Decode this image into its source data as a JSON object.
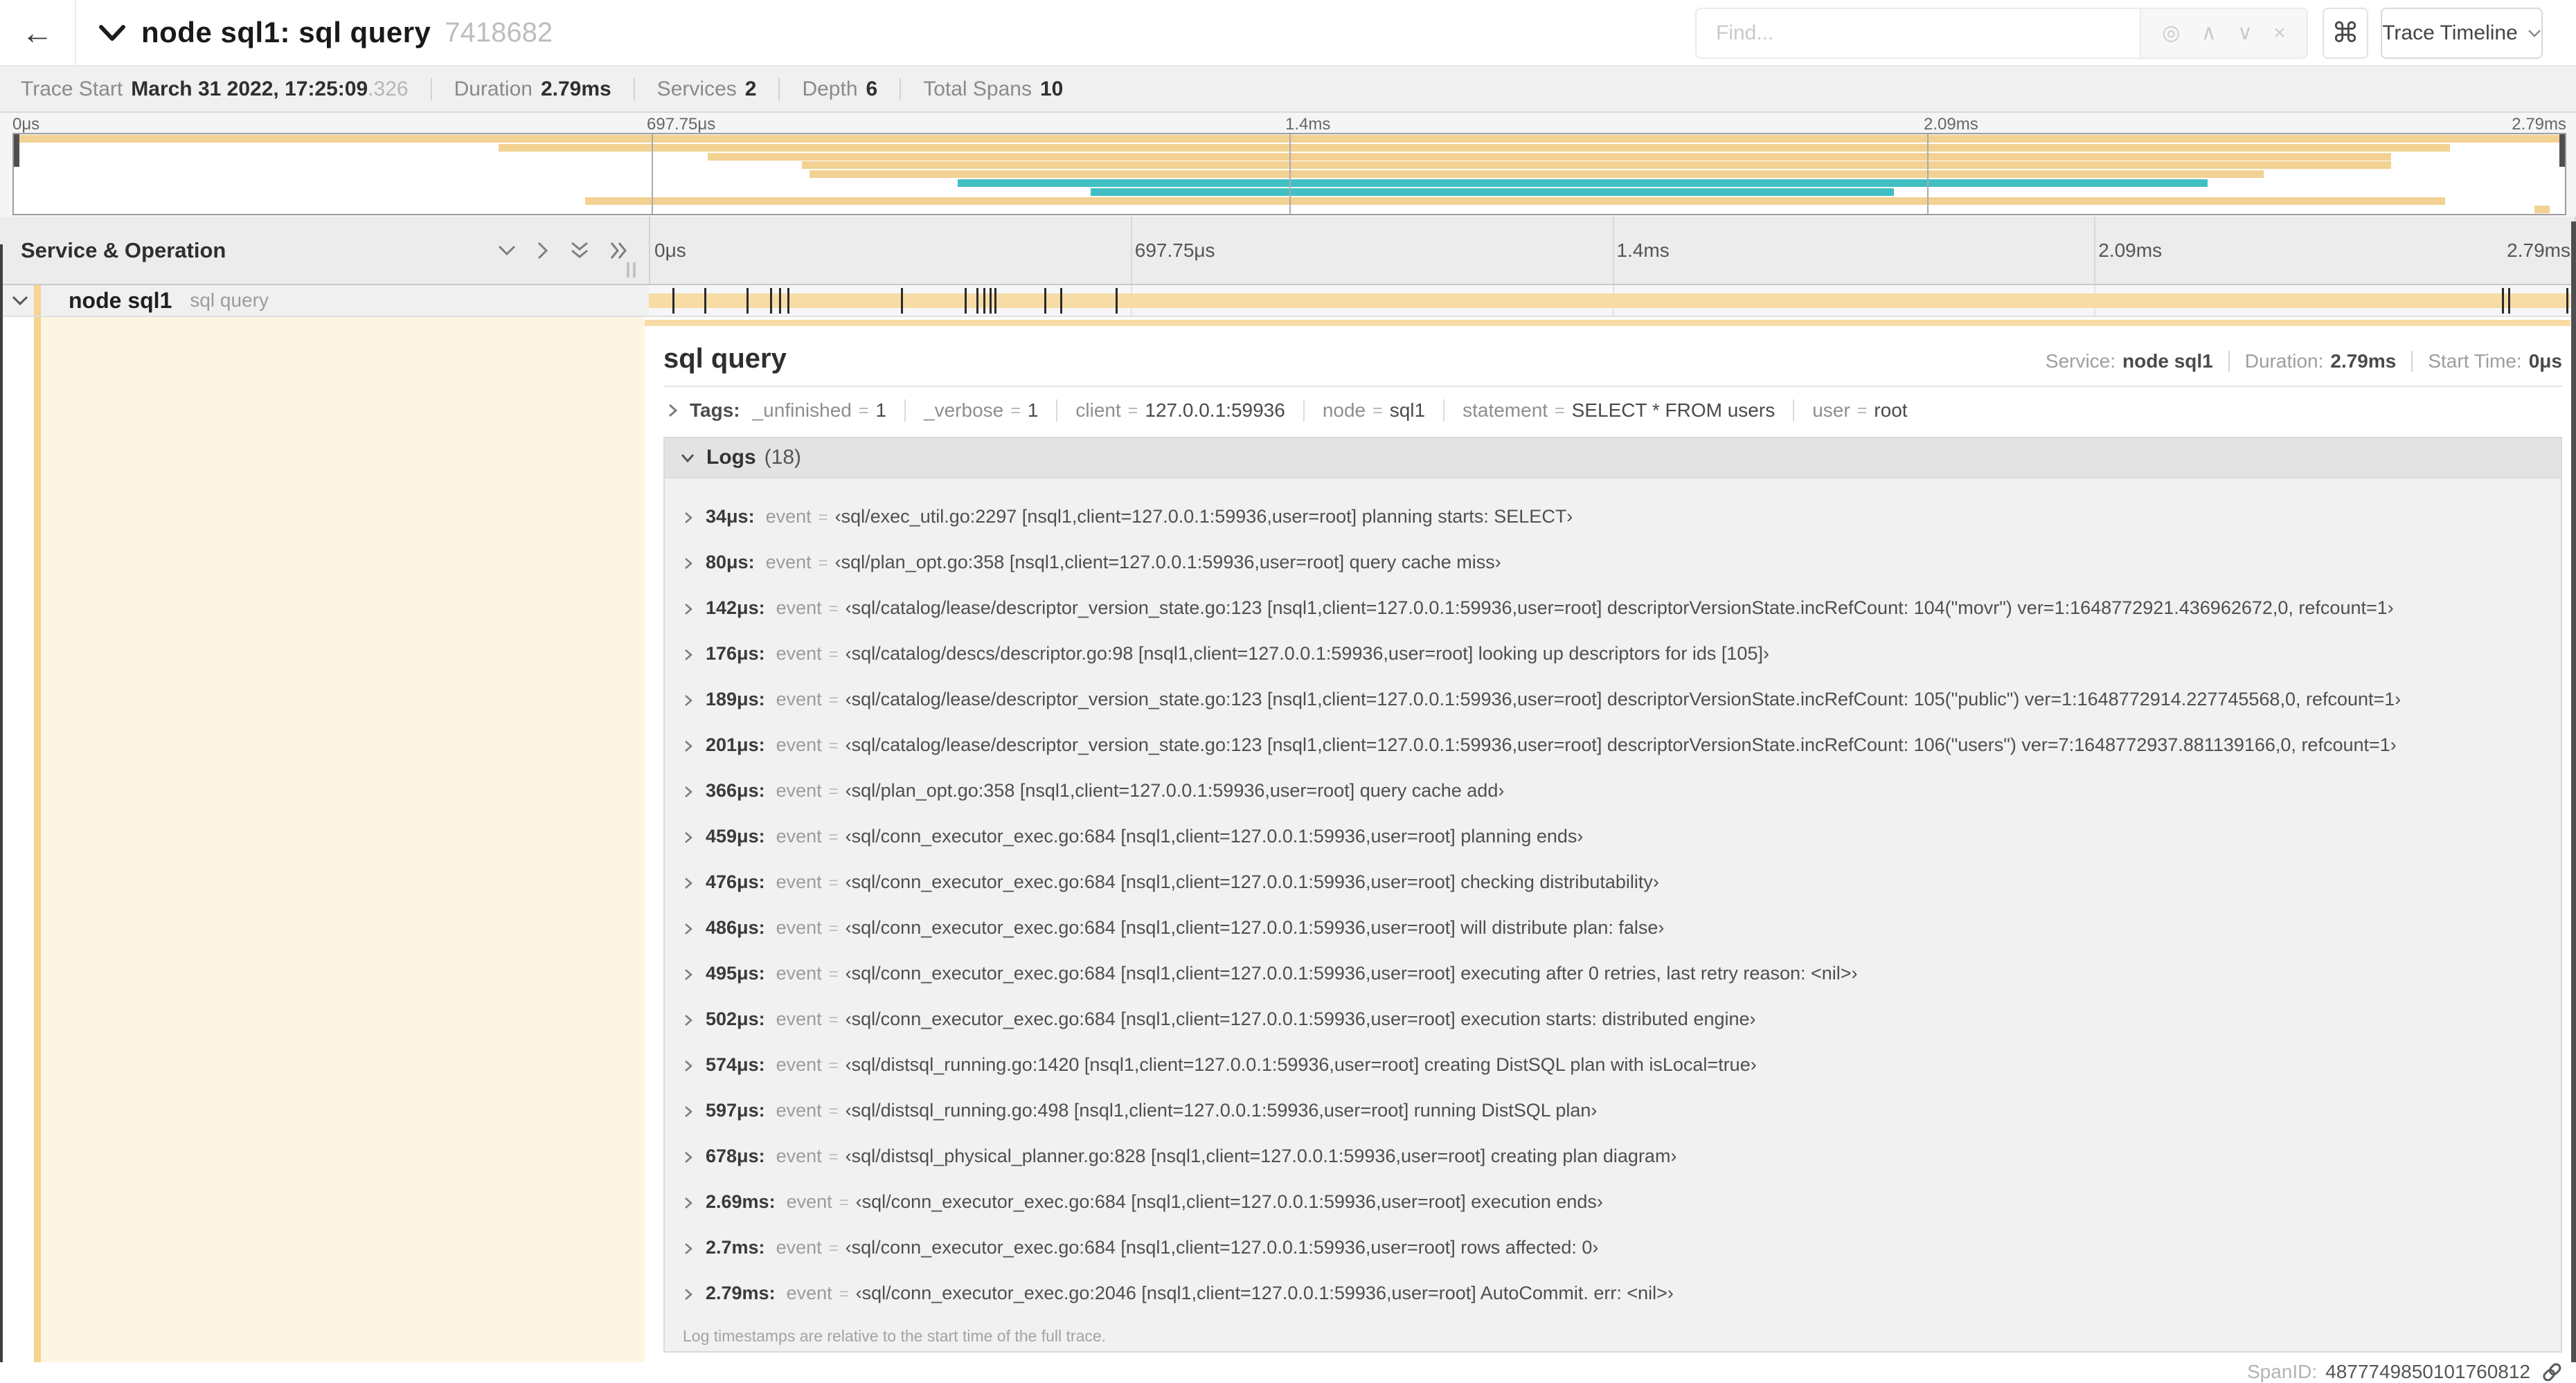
{
  "header": {
    "back_label": "←",
    "title": "node sql1: sql query",
    "trace_id": "7418682",
    "find_placeholder": "Find...",
    "locate_icon": "◎",
    "prev_icon": "∧",
    "next_icon": "∨",
    "clear_icon": "×",
    "cmd_icon": "⌘",
    "view_button": "Trace Timeline"
  },
  "trace_meta": {
    "trace_start_label": "Trace Start",
    "trace_start_value": "March 31 2022, 17:25:09",
    "trace_start_fraction": ".326",
    "duration_label": "Duration",
    "duration_value": "2.79ms",
    "services_label": "Services",
    "services_value": "2",
    "depth_label": "Depth",
    "depth_value": "6",
    "total_spans_label": "Total Spans",
    "total_spans_value": "10"
  },
  "timeline": {
    "left_header": "Service & Operation",
    "ticks": [
      "0μs",
      "697.75μs",
      "1.4ms",
      "2.09ms",
      "2.79ms"
    ],
    "tick_pcts": [
      0,
      25,
      50,
      75,
      100
    ]
  },
  "minimap": {
    "spans": [
      {
        "start_pct": 0,
        "end_pct": 100,
        "color": "#f2d192"
      },
      {
        "start_pct": 19.0,
        "end_pct": 95.5,
        "color": "#f2d192"
      },
      {
        "start_pct": 27.2,
        "end_pct": 93.2,
        "color": "#f2d192"
      },
      {
        "start_pct": 30.9,
        "end_pct": 93.2,
        "color": "#f2d192"
      },
      {
        "start_pct": 31.2,
        "end_pct": 88.2,
        "color": "#f2d192"
      },
      {
        "start_pct": 37.0,
        "end_pct": 86.0,
        "color": "#41bfc2"
      },
      {
        "start_pct": 42.2,
        "end_pct": 73.7,
        "color": "#41bfc2"
      },
      {
        "start_pct": 22.4,
        "end_pct": 95.3,
        "color": "#f2d192"
      },
      {
        "start_pct": 98.8,
        "end_pct": 99.4,
        "color": "#f2d192"
      }
    ]
  },
  "span_row": {
    "service": "node sql1",
    "operation": "sql query",
    "marker_pcts": [
      1.22,
      2.87,
      5.09,
      6.31,
      6.77,
      7.2,
      13.12,
      16.45,
      17.06,
      17.42,
      17.74,
      17.99,
      20.57,
      21.4,
      24.3,
      96.42,
      96.77,
      99.8
    ]
  },
  "detail": {
    "title": "sql query",
    "service_label": "Service:",
    "service_value": "node sql1",
    "duration_label": "Duration:",
    "duration_value": "2.79ms",
    "start_label": "Start Time:",
    "start_value": "0μs",
    "tags_label": "Tags:",
    "tags": [
      {
        "key": "_unfinished",
        "value": "1"
      },
      {
        "key": "_verbose",
        "value": "1"
      },
      {
        "key": "client",
        "value": "127.0.0.1:59936"
      },
      {
        "key": "node",
        "value": "sql1"
      },
      {
        "key": "statement",
        "value": "SELECT * FROM users"
      },
      {
        "key": "user",
        "value": "root"
      }
    ],
    "logs_label": "Logs",
    "logs_count": "(18)",
    "logs": [
      {
        "time": "34μs:",
        "field": "event",
        "value": "‹sql/exec_util.go:2297 [nsql1,client=127.0.0.1:59936,user=root] planning starts: SELECT›"
      },
      {
        "time": "80μs:",
        "field": "event",
        "value": "‹sql/plan_opt.go:358 [nsql1,client=127.0.0.1:59936,user=root] query cache miss›"
      },
      {
        "time": "142μs:",
        "field": "event",
        "value": "‹sql/catalog/lease/descriptor_version_state.go:123 [nsql1,client=127.0.0.1:59936,user=root] descriptorVersionState.incRefCount: 104(\"movr\") ver=1:1648772921.436962672,0, refcount=1›"
      },
      {
        "time": "176μs:",
        "field": "event",
        "value": "‹sql/catalog/descs/descriptor.go:98 [nsql1,client=127.0.0.1:59936,user=root] looking up descriptors for ids [105]›"
      },
      {
        "time": "189μs:",
        "field": "event",
        "value": "‹sql/catalog/lease/descriptor_version_state.go:123 [nsql1,client=127.0.0.1:59936,user=root] descriptorVersionState.incRefCount: 105(\"public\") ver=1:1648772914.227745568,0, refcount=1›"
      },
      {
        "time": "201μs:",
        "field": "event",
        "value": "‹sql/catalog/lease/descriptor_version_state.go:123 [nsql1,client=127.0.0.1:59936,user=root] descriptorVersionState.incRefCount: 106(\"users\") ver=7:1648772937.881139166,0, refcount=1›"
      },
      {
        "time": "366μs:",
        "field": "event",
        "value": "‹sql/plan_opt.go:358 [nsql1,client=127.0.0.1:59936,user=root] query cache add›"
      },
      {
        "time": "459μs:",
        "field": "event",
        "value": "‹sql/conn_executor_exec.go:684 [nsql1,client=127.0.0.1:59936,user=root] planning ends›"
      },
      {
        "time": "476μs:",
        "field": "event",
        "value": "‹sql/conn_executor_exec.go:684 [nsql1,client=127.0.0.1:59936,user=root] checking distributability›"
      },
      {
        "time": "486μs:",
        "field": "event",
        "value": "‹sql/conn_executor_exec.go:684 [nsql1,client=127.0.0.1:59936,user=root] will distribute plan: false›"
      },
      {
        "time": "495μs:",
        "field": "event",
        "value": "‹sql/conn_executor_exec.go:684 [nsql1,client=127.0.0.1:59936,user=root] executing after 0 retries, last retry reason: <nil>›"
      },
      {
        "time": "502μs:",
        "field": "event",
        "value": "‹sql/conn_executor_exec.go:684 [nsql1,client=127.0.0.1:59936,user=root] execution starts: distributed engine›"
      },
      {
        "time": "574μs:",
        "field": "event",
        "value": "‹sql/distsql_running.go:1420 [nsql1,client=127.0.0.1:59936,user=root] creating DistSQL plan with isLocal=true›"
      },
      {
        "time": "597μs:",
        "field": "event",
        "value": "‹sql/distsql_running.go:498 [nsql1,client=127.0.0.1:59936,user=root] running DistSQL plan›"
      },
      {
        "time": "678μs:",
        "field": "event",
        "value": "‹sql/distsql_physical_planner.go:828 [nsql1,client=127.0.0.1:59936,user=root] creating plan diagram›"
      },
      {
        "time": "2.69ms:",
        "field": "event",
        "value": "‹sql/conn_executor_exec.go:684 [nsql1,client=127.0.0.1:59936,user=root] execution ends›"
      },
      {
        "time": "2.7ms:",
        "field": "event",
        "value": "‹sql/conn_executor_exec.go:684 [nsql1,client=127.0.0.1:59936,user=root] rows affected: 0›"
      },
      {
        "time": "2.79ms:",
        "field": "event",
        "value": "‹sql/conn_executor_exec.go:2046 [nsql1,client=127.0.0.1:59936,user=root] AutoCommit. err: <nil>›"
      }
    ],
    "logs_note": "Log timestamps are relative to the start time of the full trace.",
    "span_id_label": "SpanID:",
    "span_id": "4877749850101760812"
  }
}
